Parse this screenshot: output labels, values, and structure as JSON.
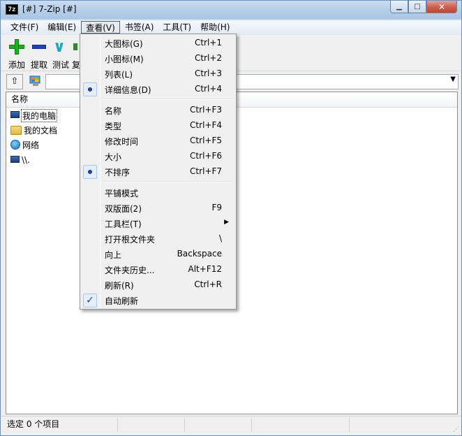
{
  "window": {
    "app_icon_text": "7z",
    "title": "[#] 7-Zip [#]"
  },
  "menubar": {
    "items": [
      "文件(F)",
      "编辑(E)",
      "查看(V)",
      "书签(A)",
      "工具(T)",
      "帮助(H)"
    ]
  },
  "toolbar": {
    "add": "添加",
    "extract": "提取",
    "test": "测试",
    "copy": "复"
  },
  "list": {
    "header_name": "名称",
    "items": [
      "我的电脑",
      "我的文档",
      "网络",
      "\\\\."
    ]
  },
  "status": {
    "selected": "选定 0 个项目"
  },
  "view_menu": {
    "items": [
      {
        "label": "大图标(G)",
        "shortcut": "Ctrl+1"
      },
      {
        "label": "小图标(M)",
        "shortcut": "Ctrl+2"
      },
      {
        "label": "列表(L)",
        "shortcut": "Ctrl+3"
      },
      {
        "label": "详细信息(D)",
        "shortcut": "Ctrl+4",
        "state": "radio-selected"
      },
      {
        "label": "名称",
        "shortcut": "Ctrl+F3"
      },
      {
        "label": "类型",
        "shortcut": "Ctrl+F4"
      },
      {
        "label": "修改时间",
        "shortcut": "Ctrl+F5"
      },
      {
        "label": "大小",
        "shortcut": "Ctrl+F6"
      },
      {
        "label": "不排序",
        "shortcut": "Ctrl+F7",
        "state": "radio-selected"
      },
      {
        "label": "平铺模式",
        "shortcut": ""
      },
      {
        "label": "双版面(2)",
        "shortcut": "F9"
      },
      {
        "label": "工具栏(T)",
        "shortcut": "",
        "submenu": true
      },
      {
        "label": "打开根文件夹",
        "shortcut": "\\"
      },
      {
        "label": "向上",
        "shortcut": "Backspace"
      },
      {
        "label": "文件夹历史...",
        "shortcut": "Alt+F12"
      },
      {
        "label": "刷新(R)",
        "shortcut": "Ctrl+R"
      },
      {
        "label": "自动刷新",
        "shortcut": "",
        "state": "checked"
      }
    ]
  },
  "colors": {
    "accent_radio": "#233e94",
    "add_icon": "#19b21b",
    "delete_icon": "#1f3fc7",
    "close_button": "#c4442f"
  }
}
